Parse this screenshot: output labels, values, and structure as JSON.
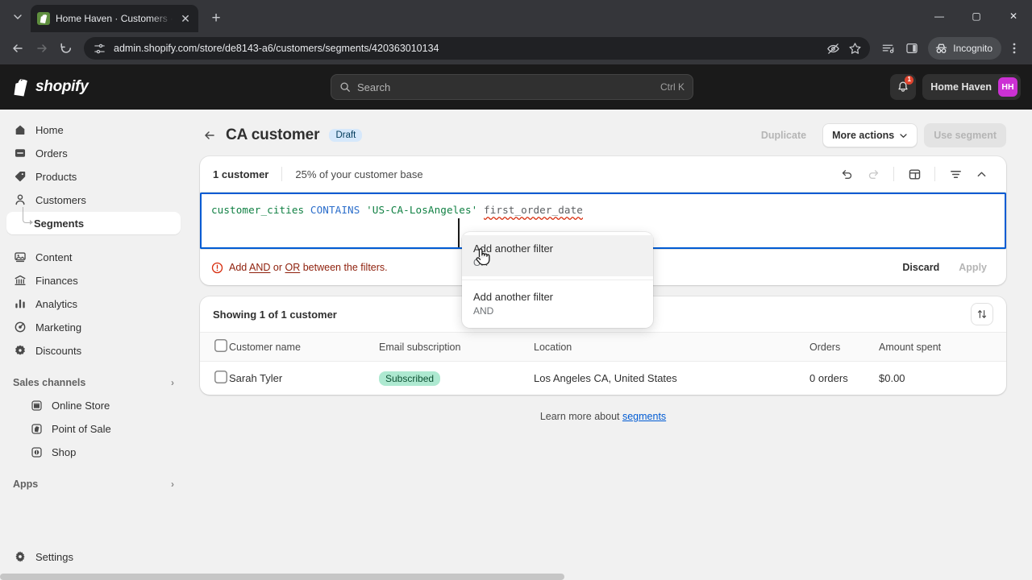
{
  "browser": {
    "tab": {
      "title": "Home Haven · Customers · Sho",
      "favicon": "shopify-favicon",
      "close_label": "✕"
    },
    "new_tab_label": "+",
    "window": {
      "minimize": "—",
      "maximize": "▢",
      "close": "✕"
    },
    "url": "admin.shopify.com/store/de8143-a6/customers/segments/420363010134",
    "incognito_label": "Incognito",
    "icons": [
      "back-arrow",
      "forward-arrow",
      "reload",
      "site-settings",
      "hide-password",
      "bookmark-star",
      "reading-list",
      "side-panel",
      "incognito",
      "chrome-menu"
    ]
  },
  "topbar": {
    "brand": "shopify",
    "search": {
      "placeholder": "Search",
      "shortcut": "Ctrl K"
    },
    "notifications_count": "1",
    "store_name": "Home Haven",
    "store_initials": "HH"
  },
  "sidebar": {
    "items": [
      {
        "label": "Home",
        "icon": "home-icon"
      },
      {
        "label": "Orders",
        "icon": "orders-icon"
      },
      {
        "label": "Products",
        "icon": "products-tag-icon"
      },
      {
        "label": "Customers",
        "icon": "customers-person-icon"
      },
      {
        "label": "Segments",
        "icon": "tree-branch-icon",
        "sub": true,
        "active": true
      },
      {
        "label": "Content",
        "icon": "content-icon"
      },
      {
        "label": "Finances",
        "icon": "finances-bank-icon"
      },
      {
        "label": "Analytics",
        "icon": "analytics-bars-icon"
      },
      {
        "label": "Marketing",
        "icon": "marketing-icon"
      },
      {
        "label": "Discounts",
        "icon": "discounts-icon"
      }
    ],
    "sections": [
      {
        "label": "Sales channels",
        "chevron": "›"
      },
      {
        "label": "Apps",
        "chevron": "›"
      }
    ],
    "channels": [
      {
        "label": "Online Store",
        "icon": "online-store-icon"
      },
      {
        "label": "Point of Sale",
        "icon": "point-of-sale-icon"
      },
      {
        "label": "Shop",
        "icon": "shop-icon"
      }
    ],
    "settings": {
      "label": "Settings",
      "icon": "gear-icon"
    }
  },
  "page": {
    "back_icon": "back-arrow-icon",
    "title": "CA customer",
    "status_badge": "Draft",
    "actions": {
      "duplicate": "Duplicate",
      "more_actions": "More actions",
      "use_segment": "Use segment"
    }
  },
  "query": {
    "customer_count": "1 customer",
    "percentage": "25% of your customer base",
    "tools": [
      {
        "name": "undo-icon",
        "glyph": "↺",
        "disabled": false
      },
      {
        "name": "redo-icon",
        "glyph": "↻",
        "disabled": true
      },
      {
        "name": "template-icon",
        "glyph": "▤",
        "disabled": false
      },
      {
        "name": "filter-icon",
        "glyph": "≡",
        "disabled": false
      },
      {
        "name": "collapse-chevron-icon",
        "glyph": "⌃",
        "disabled": false
      }
    ],
    "code": {
      "field": "customer_cities",
      "operator": "CONTAINS",
      "value": "'US-CA-LosAngeles'",
      "error_token": "first_order_date"
    },
    "error": {
      "prefix": "Add ",
      "and": "AND",
      "mid": " or ",
      "or": "OR",
      "suffix": " between the filters."
    },
    "discard_label": "Discard",
    "apply_label": "Apply"
  },
  "dropdown": {
    "items": [
      {
        "title": "Add another filter",
        "subtitle": "OR",
        "highlighted": true
      },
      {
        "title": "Add another filter",
        "subtitle": "AND",
        "highlighted": false
      }
    ]
  },
  "table": {
    "showing": "Showing 1 of 1 customer",
    "sort_icon": "sort-arrows-icon",
    "columns": [
      "Customer name",
      "Email subscription",
      "Location",
      "Orders",
      "Amount spent"
    ],
    "rows": [
      {
        "name": "Sarah Tyler",
        "email_subscription": "Subscribed",
        "location": "Los Angeles CA, United States",
        "orders": "0 orders",
        "amount_spent": "$0.00"
      }
    ]
  },
  "footer": {
    "text": "Learn more about ",
    "link": "segments"
  },
  "colors": {
    "accent": "#005bd3",
    "brand_dark": "#1a1a1a",
    "avatar": "#cc31d4",
    "success": "#aee9d1",
    "error": "#d72c0d",
    "draft_badge": "#d6e8fb"
  }
}
